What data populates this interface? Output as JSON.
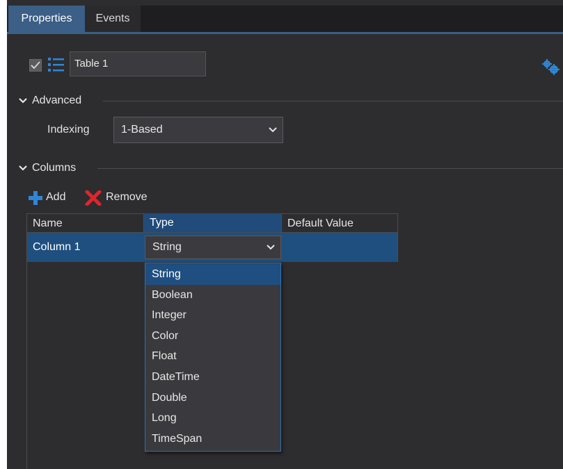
{
  "tabs": [
    {
      "label": "Properties",
      "active": true
    },
    {
      "label": "Events",
      "active": false
    }
  ],
  "object": {
    "name": "Table 1",
    "checked": true,
    "icon": "list-icon",
    "settings_icon": "gears-icon"
  },
  "advanced": {
    "header": "Advanced",
    "indexing_label": "Indexing",
    "indexing_value": "1-Based"
  },
  "columns": {
    "header": "Columns",
    "add_label": "Add",
    "remove_label": "Remove",
    "headers": [
      "Name",
      "Type",
      "Default Value"
    ],
    "rows": [
      {
        "name": "Column 1",
        "type": "String",
        "default": ""
      }
    ]
  },
  "type_dropdown": {
    "options": [
      "String",
      "Boolean",
      "Integer",
      "Color",
      "Float",
      "DateTime",
      "Double",
      "Long",
      "TimeSpan"
    ],
    "selected": "String"
  },
  "colors": {
    "panel": "#2d2d30",
    "accent": "#3b5f86",
    "selection": "#1e4f7e",
    "add_icon": "#2f86d6",
    "remove_icon": "#e0262b"
  }
}
